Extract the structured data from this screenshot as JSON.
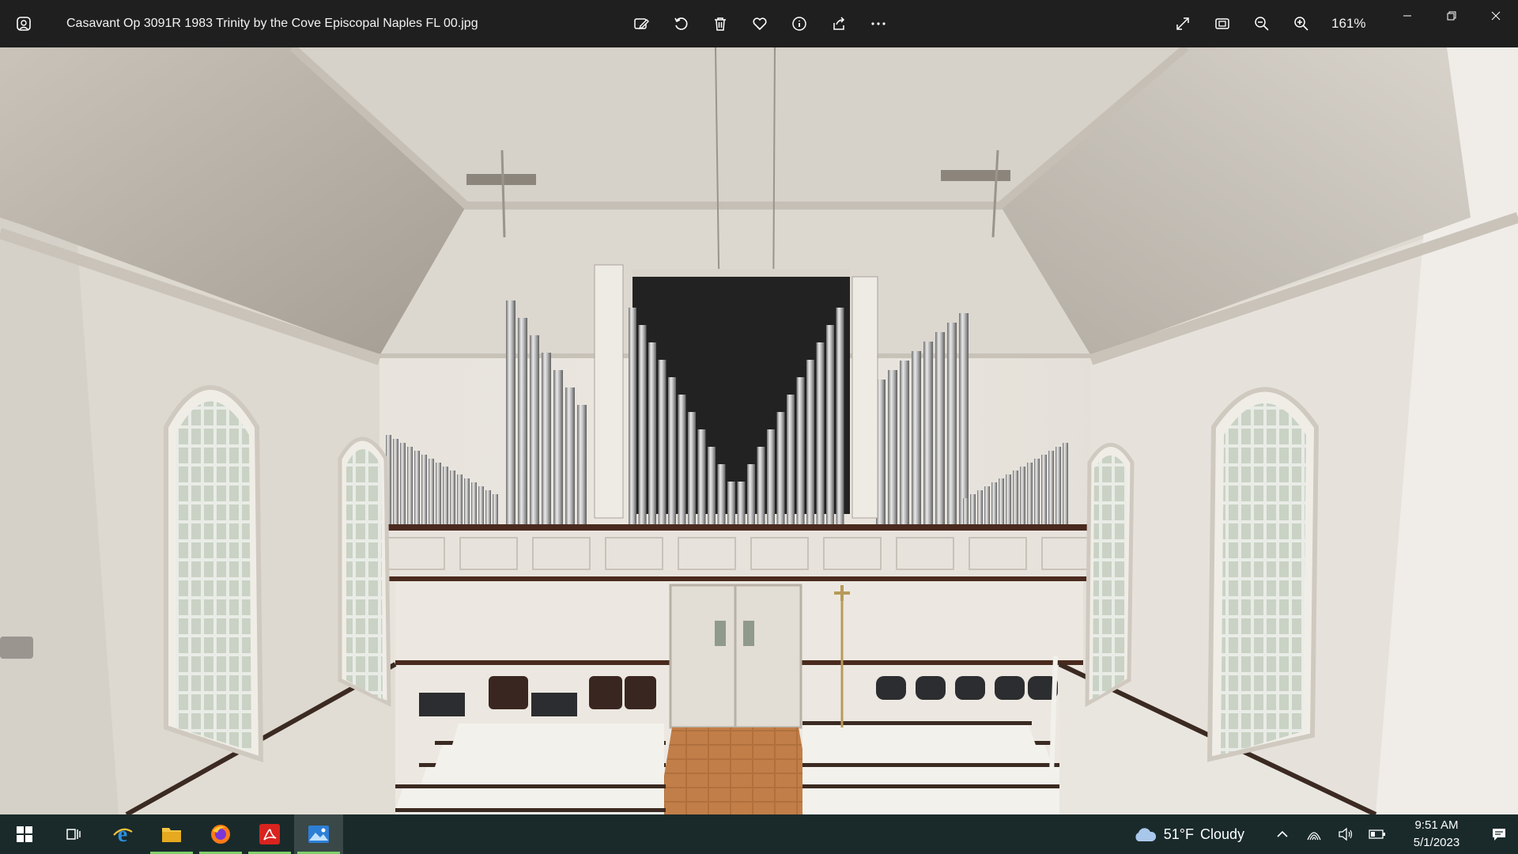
{
  "window": {
    "title": "Casavant Op 3091R 1983 Trinity by the Cove Episcopal Naples FL 00.jpg",
    "zoom_level": "161%"
  },
  "toolbar": {
    "icons": [
      "edit-image-icon",
      "rotate-icon",
      "delete-icon",
      "favorite-icon",
      "info-icon",
      "share-icon",
      "more-icon"
    ]
  },
  "view_controls": {
    "icons": [
      "fullscreen-icon",
      "fit-to-window-icon",
      "zoom-out-icon",
      "zoom-in-icon"
    ]
  },
  "window_controls": [
    "minimize",
    "restore",
    "close"
  ],
  "taskbar": {
    "apps": [
      "start",
      "task-view",
      "internet-explorer",
      "file-explorer",
      "firefox",
      "acrobat",
      "photos"
    ],
    "weather": {
      "temp": "51°F",
      "condition": "Cloudy"
    },
    "clock": {
      "time": "9:51 AM",
      "date": "5/1/2023"
    }
  },
  "colors": {
    "titlebar": "#1f1f1f",
    "taskbar": "#1a2a2a",
    "running_indicator": "#7fcf6a"
  }
}
